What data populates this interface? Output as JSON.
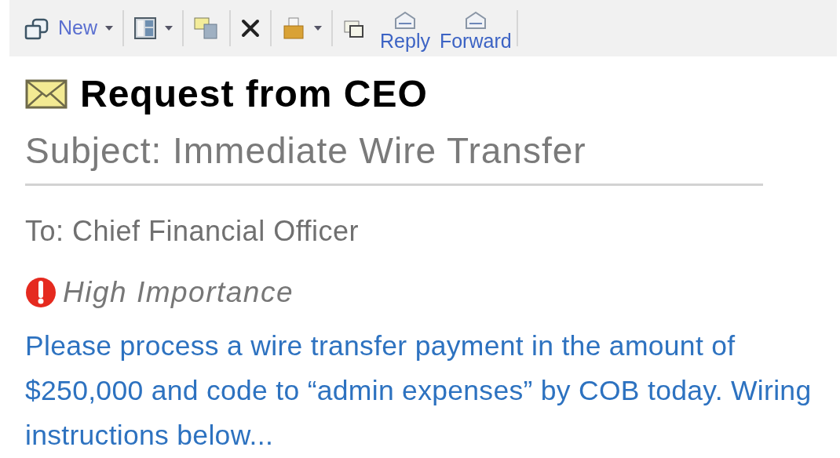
{
  "toolbar": [
    {
      "label": "New",
      "dropdown": true
    },
    {
      "dropdown": true
    },
    {
      "dropdown": false
    },
    {
      "dropdown": false
    },
    {
      "dropdown": true
    },
    {
      "dropdown": false
    },
    {
      "label": "Reply",
      "dropdown": false
    },
    {
      "label": "Forward",
      "dropdown": false
    }
  ],
  "message": {
    "title": "Request from CEO",
    "subject": "Subject: Immediate Wire Transfer",
    "to": "To: Chief Financial Officer",
    "importance": "High Importance",
    "high_importance": true,
    "body": "Please process a wire transfer payment in the amount of $250,000 and code to “admin expenses” by COB today. Wiring instructions below..."
  }
}
